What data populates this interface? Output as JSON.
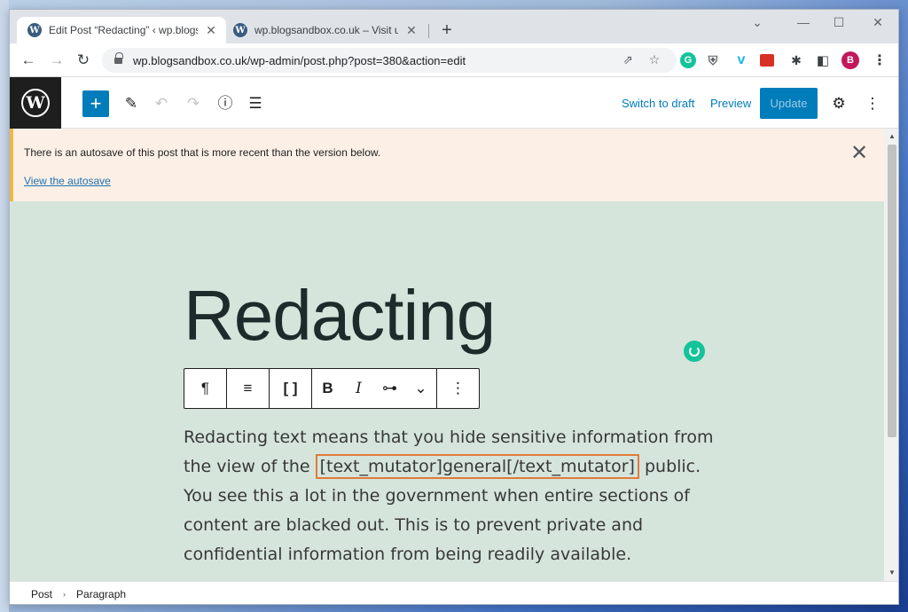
{
  "browser": {
    "tabs": [
      {
        "title": "Edit Post “Redacting” ‹ wp.blogsa",
        "close": "✕"
      },
      {
        "title": "wp.blogsandbox.co.uk – Visit us",
        "close": "✕"
      }
    ],
    "new_tab": "+",
    "window_controls": {
      "chevron": "⌄",
      "minimize": "—",
      "maximize": "☐",
      "close": "✕"
    },
    "nav": {
      "back": "←",
      "forward": "→",
      "reload": "↻"
    },
    "url": "wp.blogsandbox.co.uk/wp-admin/post.php?post=380&action=edit",
    "omnibox_icons": {
      "share": "⇗",
      "star": "☆"
    },
    "extensions": [
      {
        "name": "grammarly-icon",
        "glyph": "G"
      },
      {
        "name": "shield-icon",
        "glyph": "⛨"
      },
      {
        "name": "vimeo-icon",
        "glyph": "v"
      },
      {
        "name": "red-extension-icon",
        "glyph": "▪"
      },
      {
        "name": "puzzle-icon",
        "glyph": "✱"
      },
      {
        "name": "sidepanel-icon",
        "glyph": "◧"
      }
    ],
    "profile_initial": "B",
    "menu": "⋮"
  },
  "wp_toolbar": {
    "add": "+",
    "edit": "✎",
    "undo": "↶",
    "redo": "↷",
    "info": "ⓘ",
    "list_view": "☰",
    "switch_to_draft": "Switch to draft",
    "preview": "Preview",
    "update": "Update",
    "settings": "⚙",
    "options": "⋮"
  },
  "notice": {
    "text": "There is an autosave of this post that is more recent than the version below.",
    "link": "View the autosave",
    "close": "✕"
  },
  "post": {
    "title": "Redacting",
    "body_before": "Redacting text means that you hide sensitive information from the view of the ",
    "shortcode": "[text_mutator]general[/text_mutator]",
    "body_after": " public. You see this a lot in the government when entire sections of content are blacked out. This is to prevent private and confidential information from being readily available."
  },
  "block_toolbar": {
    "paragraph": "¶",
    "align": "≡",
    "shortcode": "[ ]",
    "bold": "B",
    "italic": "I",
    "link": "⊶",
    "more_rich": "⌄",
    "options": "⋮"
  },
  "scrollbar": {
    "up": "▲",
    "down": "▼"
  },
  "breadcrumb": {
    "items": [
      "Post",
      "Paragraph"
    ],
    "separator": "›"
  }
}
